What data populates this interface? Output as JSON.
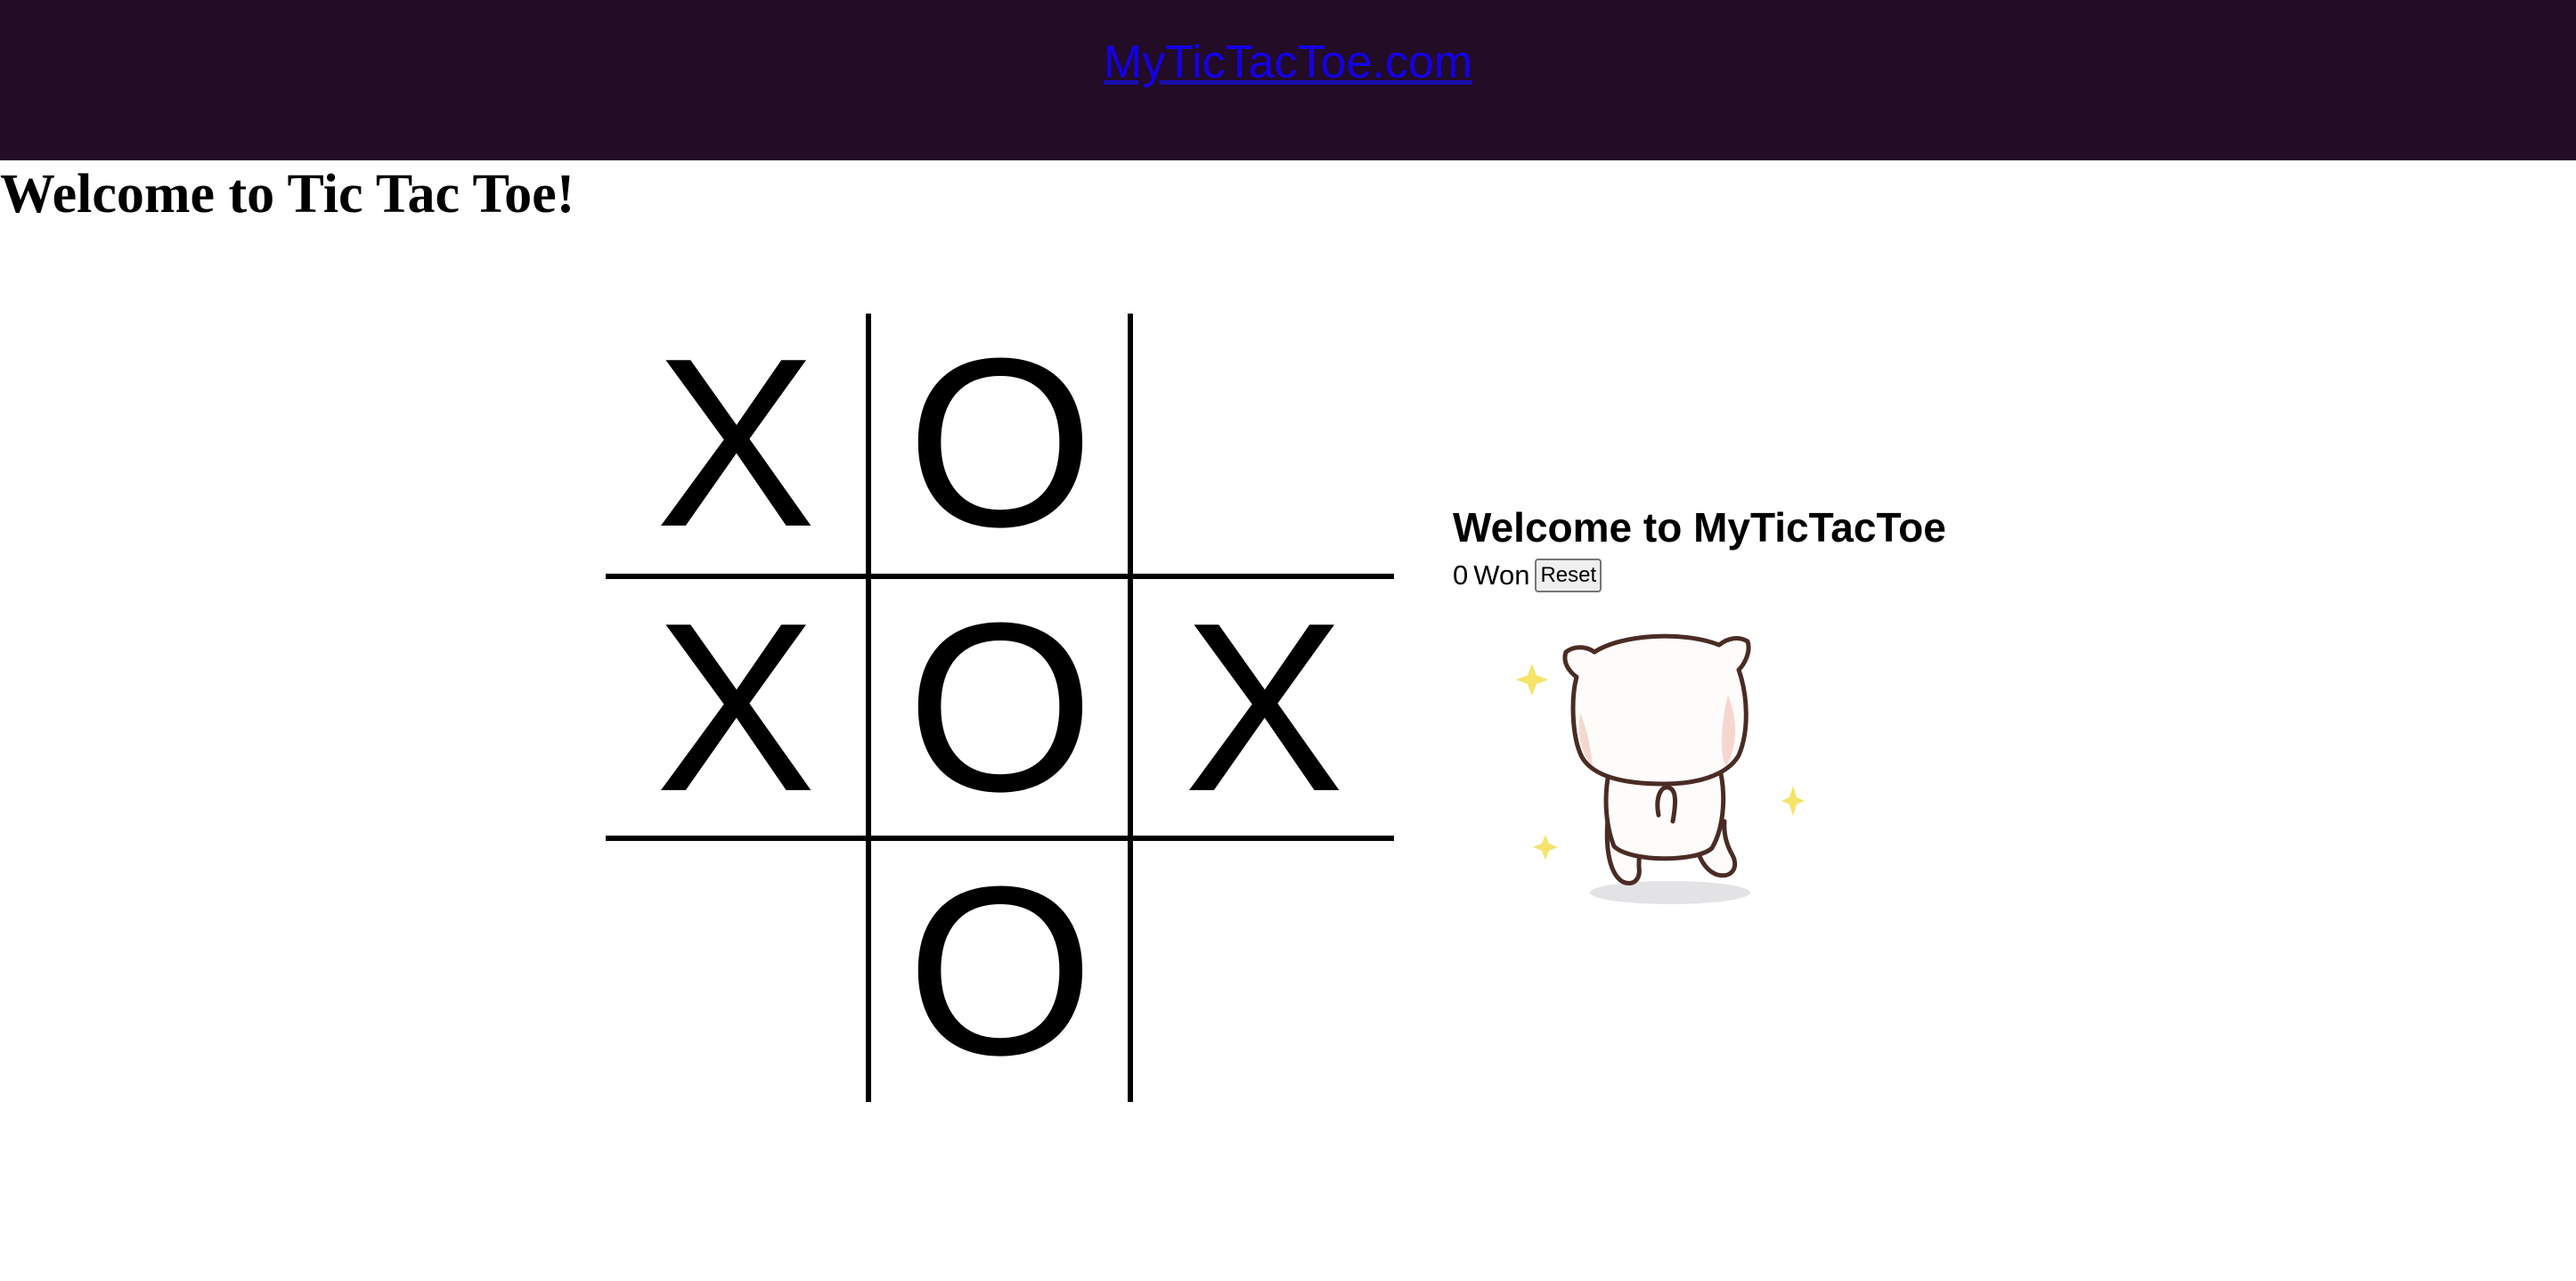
{
  "header": {
    "brand_link": "MyTicTacToe.com"
  },
  "page": {
    "title": "Welcome to Tic Tac Toe!"
  },
  "board": {
    "cells": [
      "X",
      "O",
      "",
      "X",
      "O",
      "X",
      "",
      "O",
      ""
    ]
  },
  "sidebar": {
    "title": "Welcome to MyTicTacToe",
    "won_count": "0",
    "won_label": "Won",
    "reset_label": "Reset"
  },
  "colors": {
    "header_bg": "#220c26",
    "link": "#1400e6",
    "sparkle": "#f5e36a"
  },
  "icons": {
    "mascot": "cat-walking-away-illustration"
  }
}
